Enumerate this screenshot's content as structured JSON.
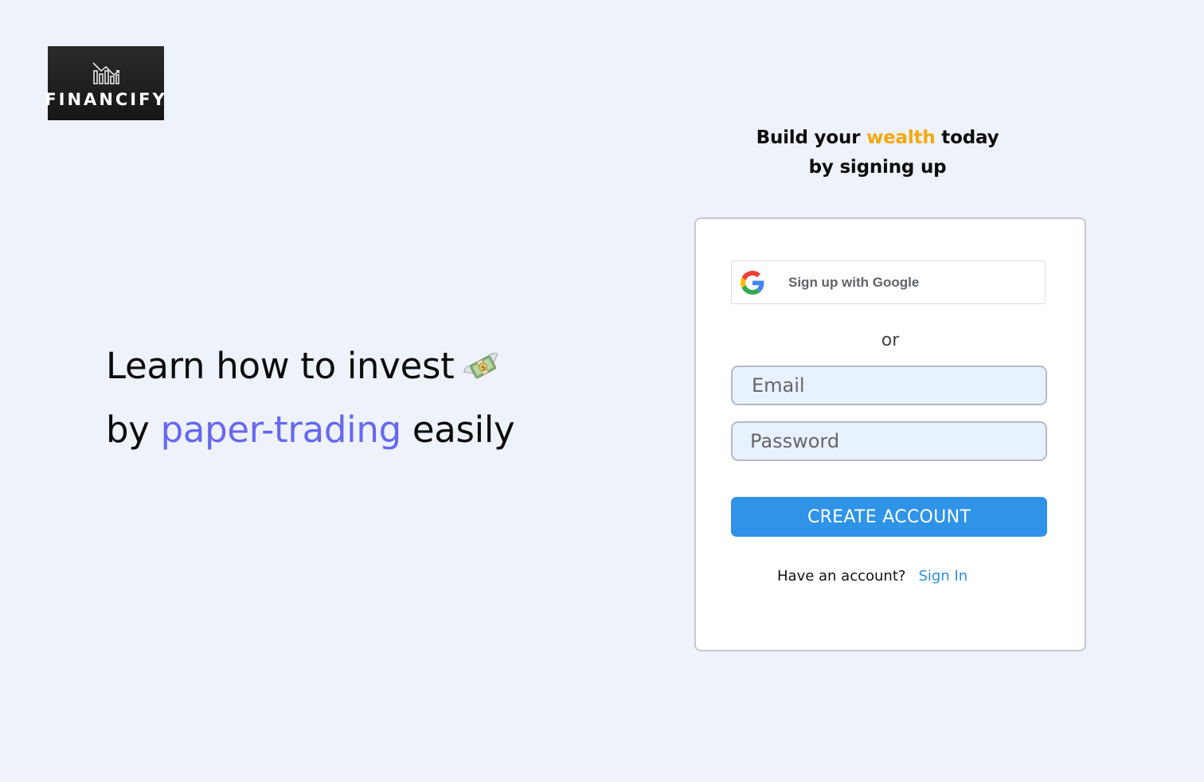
{
  "logo": {
    "text": "FINANCIFY",
    "icon": "chart-trend-icon"
  },
  "hero": {
    "line1": "Learn how to invest",
    "line2_prefix": "by ",
    "line2_accent": "paper-trading",
    "line2_suffix": " easily",
    "icon": "money-with-wings-icon"
  },
  "heading": {
    "prefix": "Build your ",
    "accent": "wealth",
    "suffix": " today",
    "line2": "by signing up"
  },
  "form": {
    "google_label": "Sign up with Google",
    "or_label": "or",
    "email_placeholder": "Email",
    "password_placeholder": "Password",
    "create_label": "CREATE ACCOUNT",
    "have_account": "Have an account?",
    "sign_in_label": "Sign In"
  },
  "colors": {
    "background": "#eef2fb",
    "hero_accent": "#6667f0",
    "heading_accent": "#f5a80c",
    "primary_button": "#2f93e8",
    "link": "#2f8fe0"
  }
}
